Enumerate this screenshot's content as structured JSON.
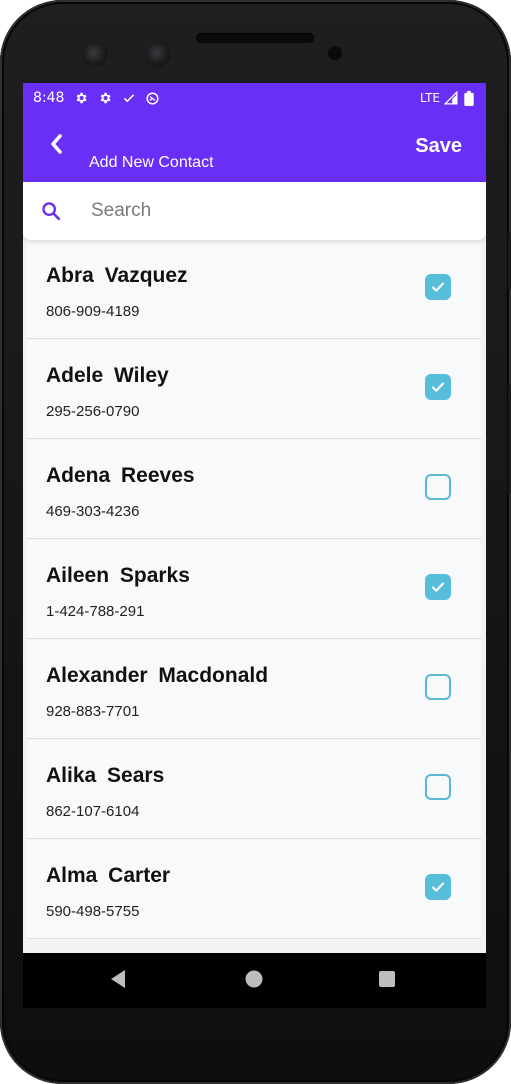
{
  "status_bar": {
    "time": "8:48",
    "network": "LTE",
    "icons": [
      "gear-icon",
      "gear-icon",
      "check-icon",
      "sync-icon",
      "signal-icon",
      "battery-icon"
    ]
  },
  "app_bar": {
    "title": "Add New Contact",
    "save_label": "Save",
    "back_icon": "chevron-left-icon"
  },
  "search": {
    "placeholder": "Search",
    "icon": "search-icon"
  },
  "contacts": [
    {
      "name": "Abra  Vazquez",
      "phone": "806-909-4189",
      "checked": true
    },
    {
      "name": "Adele  Wiley",
      "phone": "295-256-0790",
      "checked": true
    },
    {
      "name": "Adena  Reeves",
      "phone": "469-303-4236",
      "checked": false
    },
    {
      "name": "Aileen  Sparks",
      "phone": "1-424-788-291",
      "checked": true
    },
    {
      "name": "Alexander  Macdonald",
      "phone": "928-883-7701",
      "checked": false
    },
    {
      "name": "Alika  Sears",
      "phone": "862-107-6104",
      "checked": false
    },
    {
      "name": "Alma  Carter",
      "phone": "590-498-5755",
      "checked": true
    }
  ],
  "colors": {
    "primary": "#6a2ff6",
    "checkbox": "#57bdd8",
    "list_background": "#f8f9fb"
  },
  "nav_bar": {
    "icons": [
      "back-triangle-icon",
      "home-circle-icon",
      "recents-square-icon"
    ]
  }
}
